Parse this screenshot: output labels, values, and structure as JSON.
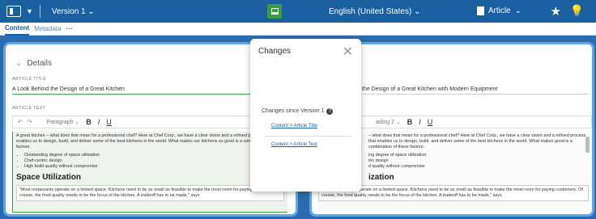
{
  "topbar": {
    "version": "Version 1",
    "language": "English (United States)",
    "article": "Article"
  },
  "subbar": {
    "content": "Content",
    "metadata": "Metadata",
    "more": "···"
  },
  "left": {
    "section": "Details",
    "article_title_label": "ARTICLE TITLE",
    "article_title": "A Look Behind the Design of a Great Kitchen",
    "article_text_label": "ARTICLE TEXT",
    "paragraph": "Paragraph",
    "body": "A great kitchen – what does that mean for a professional chef? Here at Chef Corp., we have a clear vision and a refined process that enables us to design, build, and deliver some of the best kitchens in the world. What makes our kitchens so good is a combination of these factors:",
    "bullets": [
      "Outstanding degree of space utilization",
      "Chef-centric design",
      "High build quality without compromise"
    ],
    "heading": "Space Utilization",
    "quote": "\"Most restaurants operate on a limited space. Kitchens need to be as small as feasible to make the most room for paying customers. Of course, the food quality needs to be the focus of the kitchen. A tradeoff has to be made,\" says"
  },
  "right": {
    "article_title": "the Design of a Great Kitchen with Modern Equipment",
    "heading_sel": "ading 2",
    "body": "– what does that mean for a professional chef? Here at Chef Corp., we have a clear vision and a refined process that enables us to design, build, and deliver some of the best kitchens in the world. What makes good is a combination of these factors:",
    "bullets": [
      "ing degree of space utilization",
      "tric design",
      "d quality without compromise"
    ],
    "heading": "ization",
    "quote": "\"Most restaurants operate on a limited space. Kitchens need to be as small as feasible to make the most room for paying customers. Of course, the food quality needs to be the focus of the kitchen. A tradeoff has to be made,\" says"
  },
  "popup": {
    "title": "Changes",
    "since": "Changes since Version 1",
    "change1": "Content > Article Title",
    "change2": "Content > Article Text"
  },
  "colors": {
    "topbar": "#1a5fa0",
    "accent": "#5fa8e8",
    "green": "#3d9a44"
  },
  "icons": [
    "panel-icon",
    "compare-icon",
    "document-icon",
    "star-icon",
    "lightbulb-icon",
    "close-icon",
    "help-icon"
  ]
}
